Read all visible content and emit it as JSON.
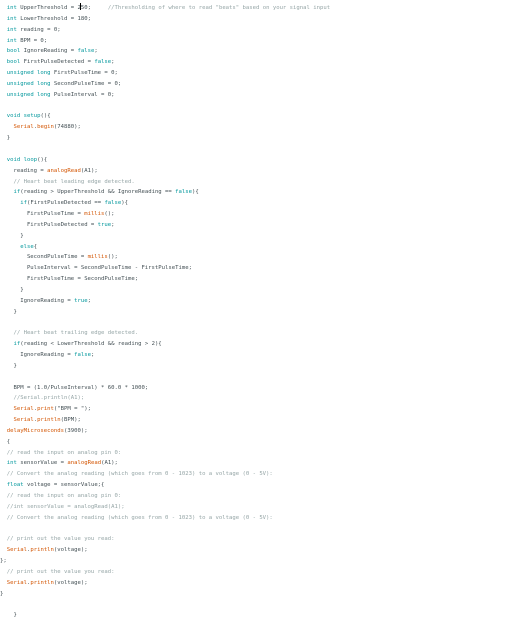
{
  "editor": {
    "lines": [
      [
        {
          "t": "  "
        },
        {
          "t": "int",
          "c": "kw"
        },
        {
          "t": " UpperThreshold = 2"
        },
        {
          "t": "",
          "cursor": true
        },
        {
          "t": "50;     "
        },
        {
          "t": "//Thresholding of where to read \"beats\" based on your signal input",
          "c": "cm"
        }
      ],
      [
        {
          "t": "  "
        },
        {
          "t": "int",
          "c": "kw"
        },
        {
          "t": " LowerThreshold = 180;"
        }
      ],
      [
        {
          "t": "  "
        },
        {
          "t": "int",
          "c": "kw"
        },
        {
          "t": " reading = 0;"
        }
      ],
      [
        {
          "t": "  "
        },
        {
          "t": "int",
          "c": "kw"
        },
        {
          "t": " BPM = 0;"
        }
      ],
      [
        {
          "t": "  "
        },
        {
          "t": "bool",
          "c": "kw"
        },
        {
          "t": " IgnoreReading = "
        },
        {
          "t": "false",
          "c": "kw"
        },
        {
          "t": ";"
        }
      ],
      [
        {
          "t": "  "
        },
        {
          "t": "bool",
          "c": "kw"
        },
        {
          "t": " FirstPulseDetected = "
        },
        {
          "t": "false",
          "c": "kw"
        },
        {
          "t": ";"
        }
      ],
      [
        {
          "t": "  "
        },
        {
          "t": "unsigned long",
          "c": "kw"
        },
        {
          "t": " FirstPulseTime = 0;"
        }
      ],
      [
        {
          "t": "  "
        },
        {
          "t": "unsigned long",
          "c": "kw"
        },
        {
          "t": " SecondPulseTime = 0;"
        }
      ],
      [
        {
          "t": "  "
        },
        {
          "t": "unsigned long",
          "c": "kw"
        },
        {
          "t": " PulseInterval = 0;"
        }
      ],
      [
        {
          "t": ""
        }
      ],
      [
        {
          "t": "  "
        },
        {
          "t": "void",
          "c": "kw"
        },
        {
          "t": " "
        },
        {
          "t": "setup",
          "c": "kw"
        },
        {
          "t": "(){"
        }
      ],
      [
        {
          "t": "    "
        },
        {
          "t": "Serial",
          "c": "fn"
        },
        {
          "t": "."
        },
        {
          "t": "begin",
          "c": "fn"
        },
        {
          "t": "(74880);"
        }
      ],
      [
        {
          "t": "  }"
        }
      ],
      [
        {
          "t": ""
        }
      ],
      [
        {
          "t": "  "
        },
        {
          "t": "void",
          "c": "kw"
        },
        {
          "t": " "
        },
        {
          "t": "loop",
          "c": "kw"
        },
        {
          "t": "(){"
        }
      ],
      [
        {
          "t": "    reading = "
        },
        {
          "t": "analogRead",
          "c": "fn"
        },
        {
          "t": "(A1);"
        }
      ],
      [
        {
          "t": "    // Heart beat leading edge detected."
        }
      ],
      [
        {
          "t": "    "
        },
        {
          "t": "if",
          "c": "kw"
        },
        {
          "t": "(reading > UpperThreshold && IgnoreReading == "
        },
        {
          "t": "false",
          "c": "kw"
        },
        {
          "t": "){"
        }
      ],
      [
        {
          "t": "      "
        },
        {
          "t": "if",
          "c": "kw"
        },
        {
          "t": "(FirstPulseDetected == "
        },
        {
          "t": "false",
          "c": "kw"
        },
        {
          "t": "){"
        }
      ],
      [
        {
          "t": "        FirstPulseTime = "
        },
        {
          "t": "millis",
          "c": "fn"
        },
        {
          "t": "();"
        }
      ],
      [
        {
          "t": "        FirstPulseDetected = "
        },
        {
          "t": "true",
          "c": "kw"
        },
        {
          "t": ";"
        }
      ],
      [
        {
          "t": "      }"
        }
      ],
      [
        {
          "t": "      "
        },
        {
          "t": "else",
          "c": "kw"
        },
        {
          "t": "{"
        }
      ],
      [
        {
          "t": "        SecondPulseTime = "
        },
        {
          "t": "millis",
          "c": "fn"
        },
        {
          "t": "();"
        }
      ],
      [
        {
          "t": "        PulseInterval = SecondPulseTime - FirstPulseTime;"
        }
      ],
      [
        {
          "t": "        FirstPulseTime = SecondPulseTime;"
        }
      ],
      [
        {
          "t": "      }"
        }
      ],
      [
        {
          "t": "      IgnoreReading = "
        },
        {
          "t": "true",
          "c": "kw"
        },
        {
          "t": ";"
        }
      ],
      [
        {
          "t": "    }"
        }
      ],
      [
        {
          "t": ""
        }
      ],
      [
        {
          "t": "    // Heart beat trailing edge detected."
        }
      ],
      [
        {
          "t": "    "
        },
        {
          "t": "if",
          "c": "kw"
        },
        {
          "t": "(reading < LowerThreshold && reading > 2){"
        }
      ],
      [
        {
          "t": "      IgnoreReading = "
        },
        {
          "t": "false",
          "c": "kw"
        },
        {
          "t": ";"
        }
      ],
      [
        {
          "t": "    }"
        }
      ],
      [
        {
          "t": ""
        }
      ],
      [
        {
          "t": "    BPM = (1.0/PulseInterval) * 60.0 * 1000;"
        }
      ],
      [
        {
          "t": "    //Serial.println(A1);"
        }
      ],
      [
        {
          "t": "    "
        },
        {
          "t": "Serial",
          "c": "fn"
        },
        {
          "t": "."
        },
        {
          "t": "print",
          "c": "fn"
        },
        {
          "t": "(\"BPM = \");"
        }
      ],
      [
        {
          "t": "    "
        },
        {
          "t": "Serial",
          "c": "fn"
        },
        {
          "t": "."
        },
        {
          "t": "println",
          "c": "fn"
        },
        {
          "t": "(BPM);"
        }
      ],
      [
        {
          "t": "  "
        },
        {
          "t": "delayMicroseconds",
          "c": "fn"
        },
        {
          "t": "(3900);"
        }
      ],
      [
        {
          "t": "  {"
        }
      ],
      [
        {
          "t": "  // read the input on analog pin 0:"
        }
      ],
      [
        {
          "t": "  "
        },
        {
          "t": "int",
          "c": "kw"
        },
        {
          "t": " sensorValue = "
        },
        {
          "t": "analogRead",
          "c": "fn"
        },
        {
          "t": "(A1);"
        }
      ],
      [
        {
          "t": "  // Convert the analog reading (which goes from 0 - 1023) to a voltage (0 - 5V):"
        }
      ],
      [
        {
          "t": "  "
        },
        {
          "t": "float",
          "c": "kw"
        },
        {
          "t": " voltage = sensorValue;{"
        }
      ],
      [
        {
          "t": "  // read the input on analog pin 0:"
        }
      ],
      [
        {
          "t": "  //int sensorValue = analogRead(A1);"
        }
      ],
      [
        {
          "t": "  // Convert the analog reading (which goes from 0 - 1023) to a voltage (0 - 5V):"
        }
      ],
      [
        {
          "t": ""
        }
      ],
      [
        {
          "t": "  // print out the value you read:"
        }
      ],
      [
        {
          "t": "  "
        },
        {
          "t": "Serial",
          "c": "fn"
        },
        {
          "t": "."
        },
        {
          "t": "println",
          "c": "fn"
        },
        {
          "t": "(voltage);"
        }
      ],
      [
        {
          "t": "};"
        }
      ],
      [
        {
          "t": "  // print out the value you read:"
        }
      ],
      [
        {
          "t": "  "
        },
        {
          "t": "Serial",
          "c": "fn"
        },
        {
          "t": "."
        },
        {
          "t": "println",
          "c": "fn"
        },
        {
          "t": "(voltage);"
        }
      ],
      [
        {
          "t": "}"
        }
      ],
      [
        {
          "t": ""
        }
      ],
      [
        {
          "t": "    }"
        }
      ]
    ]
  }
}
